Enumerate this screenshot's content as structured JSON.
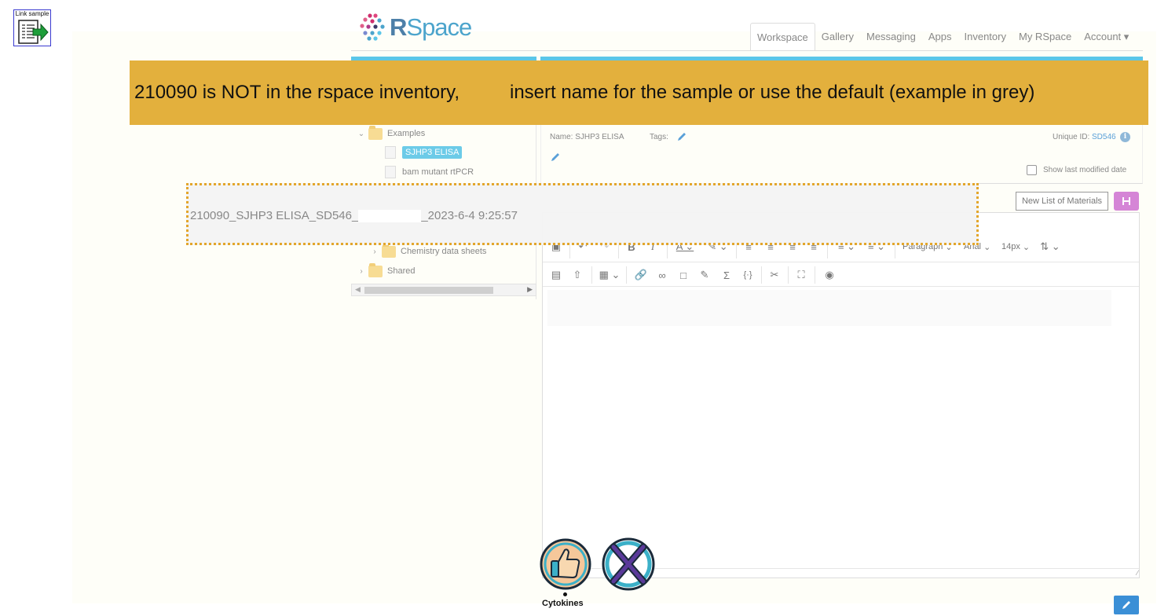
{
  "link_sample": {
    "label": "Link sample",
    "icon": "link-sample-icon"
  },
  "logo": {
    "r": "R",
    "rest": "Space"
  },
  "nav": {
    "items": [
      "Workspace",
      "Gallery",
      "Messaging",
      "Apps",
      "Inventory",
      "My RSpace",
      "Account ▾"
    ],
    "active": "Workspace"
  },
  "banner": {
    "left_text": "210090 is NOT in the rspace inventory,",
    "right_text": "insert name for the sample or use the default (example in grey)"
  },
  "tree": {
    "examples": "Examples",
    "selected_doc": "SJHP3 ELISA",
    "doc2": "bam mutant rtPCR",
    "chem": "Chemistry data sheets",
    "shared": "Shared"
  },
  "doc_header": {
    "name": "Name: SJHP3 ELISA",
    "tags": "Tags:",
    "unique_id_label": "Unique ID:",
    "unique_id": "SD546",
    "show_last_modified": "Show last modified date"
  },
  "buttons": {
    "new_list": "New List of Materials"
  },
  "editor": {
    "paragraph": "Paragraph",
    "font": "Arial",
    "size": "14px"
  },
  "default_name": {
    "prefix": "210090_SJHP3 ELISA_SD546_",
    "suffix": "_2023-6-4 9:25:57"
  },
  "bottom": {
    "label": "Cytokines"
  },
  "colors": {
    "banner": "#e3b03d",
    "accent": "#5bc6e8",
    "save": "#d585d6",
    "link": "#3b8fd6"
  }
}
